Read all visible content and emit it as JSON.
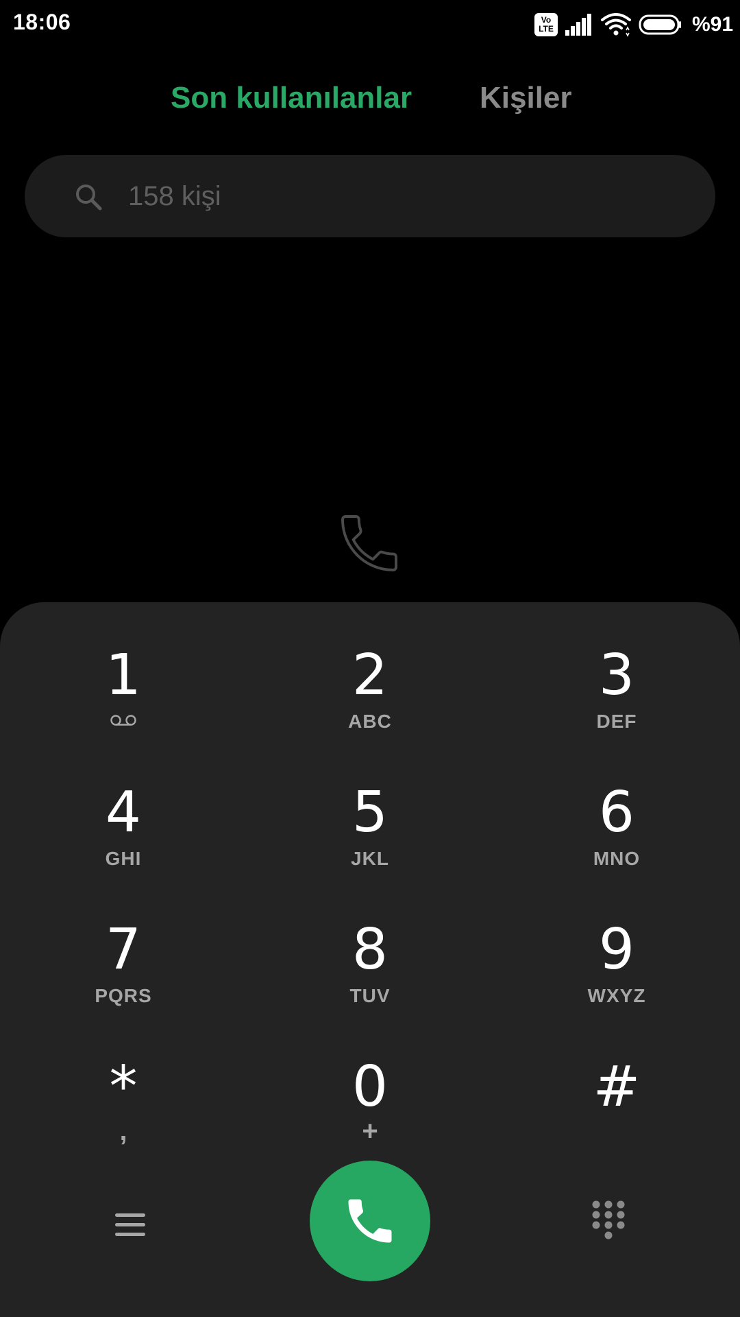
{
  "status_bar": {
    "time": "18:06",
    "volte_top": "Vo",
    "volte_bottom": "LTE",
    "battery_text": "%91"
  },
  "tabs": {
    "recents": "Son kullanılanlar",
    "contacts": "Kişiler",
    "active": "recents"
  },
  "search": {
    "placeholder": "158 kişi"
  },
  "dialpad": {
    "keys": [
      {
        "digit": "1",
        "letters": "",
        "icon": "voicemail-icon"
      },
      {
        "digit": "2",
        "letters": "ABC"
      },
      {
        "digit": "3",
        "letters": "DEF"
      },
      {
        "digit": "4",
        "letters": "GHI"
      },
      {
        "digit": "5",
        "letters": "JKL"
      },
      {
        "digit": "6",
        "letters": "MNO"
      },
      {
        "digit": "7",
        "letters": "PQRS"
      },
      {
        "digit": "8",
        "letters": "TUV"
      },
      {
        "digit": "9",
        "letters": "WXYZ"
      },
      {
        "digit": "*",
        "letters": ","
      },
      {
        "digit": "0",
        "letters": "+"
      },
      {
        "digit": "#",
        "letters": ""
      }
    ]
  },
  "colors": {
    "accent": "#2aa865",
    "call_button": "#27a862",
    "background": "#000000",
    "dialpad_bg": "#232323",
    "search_bg": "#1c1c1c",
    "inactive_tab": "#8a8a8a",
    "key_letters": "#a7a7a7"
  },
  "icons": {
    "status": [
      "volte-icon",
      "signal-icon",
      "wifi-icon",
      "battery-icon"
    ],
    "empty_state": "phone-icon",
    "bottom": [
      "menu-icon",
      "call-icon",
      "dialpad-icon"
    ]
  }
}
